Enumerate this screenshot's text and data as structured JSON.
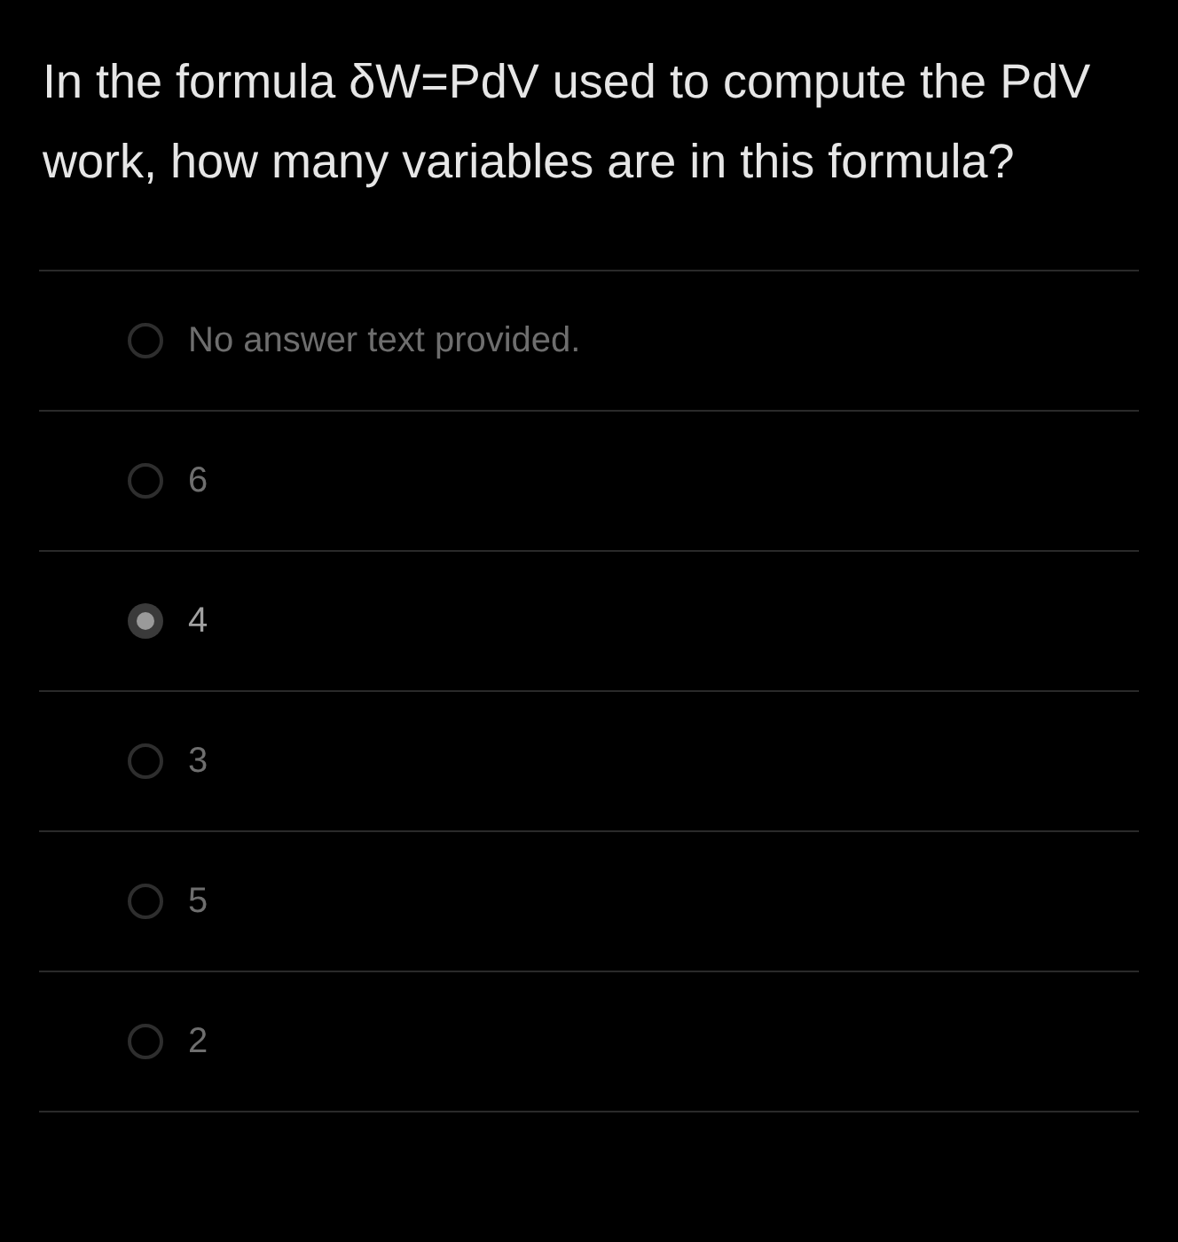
{
  "question": "In the formula δW=PdV used to compute the PdV work, how many variables are in this formula?",
  "options": [
    {
      "label": "No answer text provided.",
      "selected": false
    },
    {
      "label": "6",
      "selected": false
    },
    {
      "label": "4",
      "selected": true
    },
    {
      "label": "3",
      "selected": false
    },
    {
      "label": "5",
      "selected": false
    },
    {
      "label": "2",
      "selected": false
    }
  ]
}
